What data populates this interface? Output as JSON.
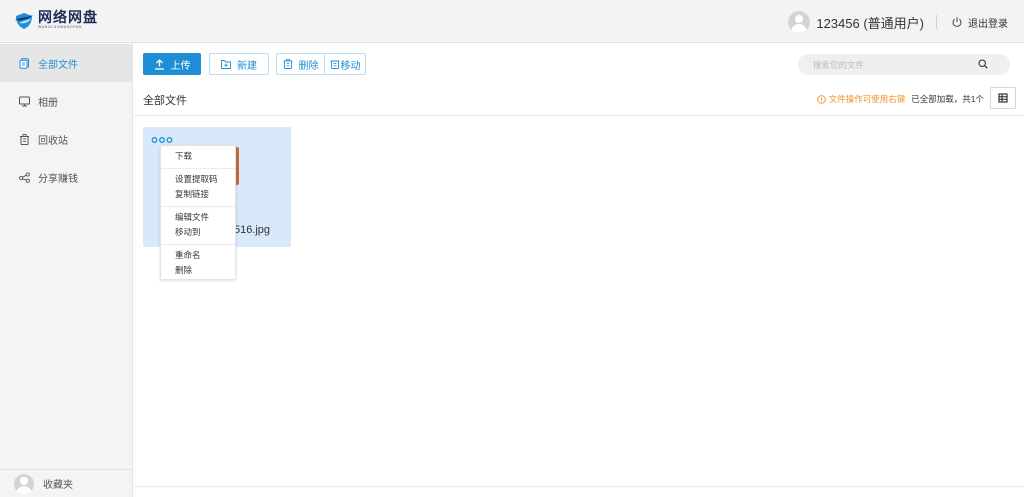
{
  "header": {
    "logo_title": "网络网盘",
    "logo_subtitle": "WANGLUOWANGPAN",
    "username": "123456 (普通用户)",
    "logout_label": "退出登录"
  },
  "sidebar": {
    "items": [
      {
        "label": "全部文件",
        "icon": "file-icon",
        "active": true
      },
      {
        "label": "相册",
        "icon": "monitor-icon",
        "active": false
      },
      {
        "label": "回收站",
        "icon": "trash-icon",
        "active": false
      },
      {
        "label": "分享赚钱",
        "icon": "share-icon",
        "active": false
      }
    ],
    "bottom_label": "收藏夹"
  },
  "toolbar": {
    "upload_label": "上传",
    "new_label": "新建",
    "delete_label": "删除",
    "move_label": "移动"
  },
  "search": {
    "placeholder": "搜索您的文件"
  },
  "pathbar": {
    "breadcrumb": "全部文件",
    "hint_warning": "文件操作可使用右键",
    "hint_info": "已全部加载，共1个"
  },
  "file": {
    "name_visible": "516.jpg",
    "sub_visible": "*"
  },
  "context_menu": {
    "groups": [
      [
        "下载"
      ],
      [
        "设置提取码",
        "复制链接"
      ],
      [
        "编辑文件",
        "移动到"
      ],
      [
        "重命名",
        "删除"
      ]
    ]
  },
  "colors": {
    "accent": "#1e8fd6",
    "warning": "#f2912a",
    "selected_bg": "#d7e9fa",
    "thumb": "#c76a3a"
  }
}
